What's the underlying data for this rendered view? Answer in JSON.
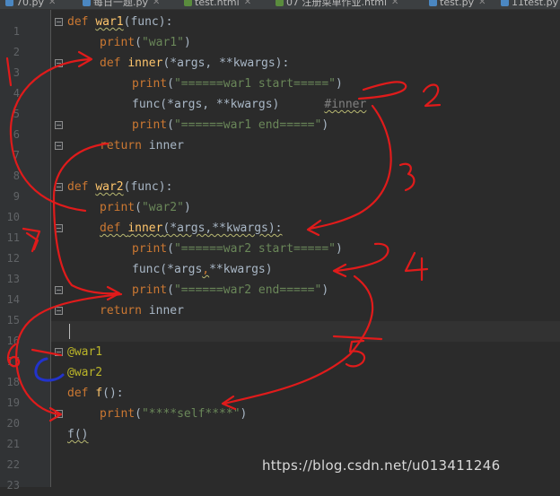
{
  "tabs": [
    {
      "label": "70.py",
      "icon_color": "#4b87c1"
    },
    {
      "label": "每日一题.py",
      "icon_color": "#4b87c1"
    },
    {
      "label": "test.html",
      "icon_color": "#5a8c3d"
    },
    {
      "label": "07 注册菜单作业.html",
      "icon_color": "#5a8c3d"
    },
    {
      "label": "test.py",
      "icon_color": "#4b87c1"
    },
    {
      "label": "11test.py",
      "icon_color": "#4b87c1"
    }
  ],
  "line_numbers": [
    "1",
    "2",
    "3",
    "4",
    "5",
    "6",
    "7",
    "8",
    "9",
    "10",
    "11",
    "12",
    "13",
    "14",
    "15",
    "16",
    "17",
    "18",
    "19",
    "20",
    "21",
    "22",
    "23"
  ],
  "code": {
    "l1": {
      "kw": "def ",
      "name": "war1",
      "rest": "(func):"
    },
    "l2": {
      "fn": "print",
      "open": "(",
      "s": "\"war1\"",
      "close": ")"
    },
    "l3": {
      "kw": "def ",
      "name": "inner",
      "rest": "(*args, **kwargs):"
    },
    "l4": {
      "fn": "print",
      "open": "(",
      "s": "\"======war1 start=====\"",
      "close": ")"
    },
    "l5": {
      "a": "func(*args, **kwargs)",
      "comment": "#inner"
    },
    "l6": {
      "fn": "print",
      "open": "(",
      "s": "\"======war1 end=====\"",
      "close": ")"
    },
    "l7": {
      "kw": "return ",
      "rest": "inner"
    },
    "l9": {
      "kw": "def ",
      "name": "war2",
      "rest": "(func):"
    },
    "l10": {
      "fn": "print",
      "open": "(",
      "s": "\"war2\"",
      "close": ")"
    },
    "l11": {
      "kw": "def ",
      "name": "inner",
      "rest": "(*args,**kwargs):"
    },
    "l12": {
      "fn": "print",
      "open": "(",
      "s": "\"======war2 start=====\"",
      "close": ")"
    },
    "l13": {
      "a": "func(*args",
      "comma": ",",
      "b": "**kwargs)"
    },
    "l14": {
      "fn": "print",
      "open": "(",
      "s": "\"======war2 end=====\"",
      "close": ")"
    },
    "l15": {
      "kw": "return ",
      "rest": "inner"
    },
    "l17": {
      "dec": "@war1"
    },
    "l18": {
      "dec": "@war2"
    },
    "l19": {
      "kw": "def ",
      "name": "f",
      "rest": "():"
    },
    "l20": {
      "fn": "print",
      "open": "(",
      "s": "\"****self****\"",
      "close": ")"
    },
    "l21": {
      "a": "f()"
    }
  },
  "annotations": {
    "labels": [
      "1",
      "2",
      "3",
      "4",
      "5",
      "6",
      "7"
    ],
    "pen_color": "#e01b1b",
    "highlight_color": "#2233cc"
  },
  "watermark": "https://blog.csdn.net/u013411246"
}
